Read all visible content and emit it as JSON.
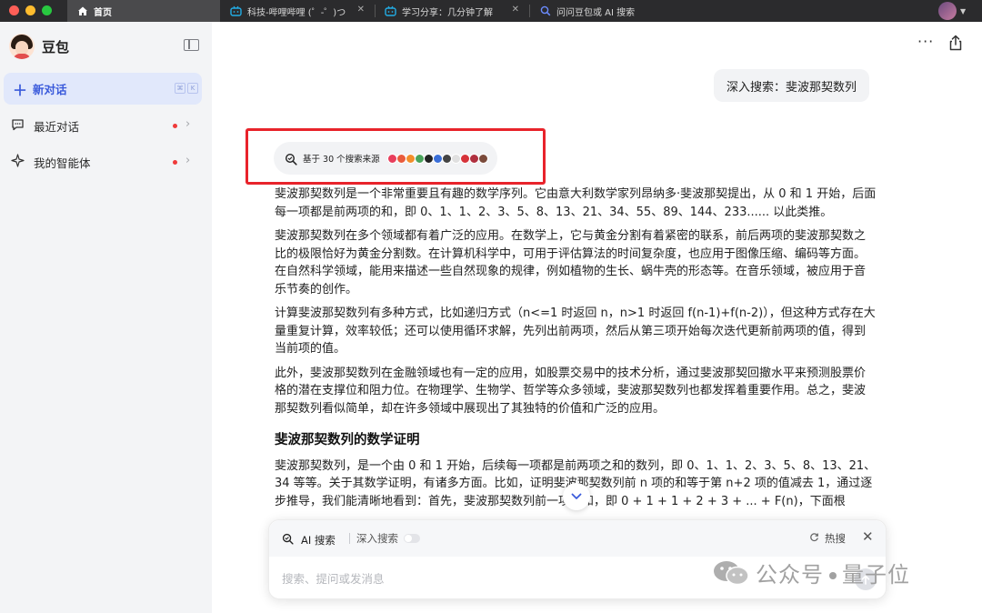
{
  "browser": {
    "tabs": [
      {
        "title": "首页",
        "active": true
      },
      {
        "title": "科技-哔哩哔哩 (゜-゜)つ",
        "active": false
      },
      {
        "title": "学习分享：几分钟了解",
        "active": false
      },
      {
        "title": "问问豆包或 AI 搜索",
        "active": false
      }
    ],
    "close_glyph": "✕"
  },
  "sidebar": {
    "brand": "豆包",
    "new_chat": {
      "label": "新对话",
      "shortcut": [
        "⌘",
        "K"
      ]
    },
    "items": [
      {
        "label": "最近对话",
        "icon": "chat-bubble-icon",
        "has_dot": true
      },
      {
        "label": "我的智能体",
        "icon": "sparkle-icon",
        "has_dot": true
      }
    ],
    "colors": {
      "accent": "#3b5bdb",
      "dot": "#ef3a3a",
      "bg": "#f3f4f6"
    }
  },
  "header": {
    "more": "···"
  },
  "conversation": {
    "user_query": "深入搜索：斐波那契数列",
    "sources_label": "基于 30 个搜索来源",
    "source_colors": [
      "#e83e5c",
      "#e95b3c",
      "#f28e2b",
      "#4aa35b",
      "#222222",
      "#3a6fd8",
      "#444444",
      "#e0e0e0",
      "#d6333a",
      "#b0303f",
      "#7a4a3a"
    ],
    "answer_paragraphs": [
      "斐波那契数列是一个非常重要且有趣的数学序列。它由意大利数学家列昂纳多·斐波那契提出，从 0 和 1 开始，后面每一项都是前两项的和，即 0、1、1、2、3、5、8、13、21、34、55、89、144、233...... 以此类推。",
      "斐波那契数列在多个领域都有着广泛的应用。在数学上，它与黄金分割有着紧密的联系，前后两项的斐波那契数之比的极限恰好为黄金分割数。在计算机科学中，可用于评估算法的时间复杂度，也应用于图像压缩、编码等方面。在自然科学领域，能用来描述一些自然现象的规律，例如植物的生长、蜗牛壳的形态等。在音乐领域，被应用于音乐节奏的创作。",
      "计算斐波那契数列有多种方式，比如递归方式（n<=1 时返回 n，n>1 时返回 f(n-1)+f(n-2)），但这种方式存在大量重复计算，效率较低；还可以使用循环求解，先列出前两项，然后从第三项开始每次迭代更新前两项的值，得到当前项的值。",
      "此外，斐波那契数列在金融领域也有一定的应用，如股票交易中的技术分析，通过斐波那契回撤水平来预测股票价格的潜在支撑位和阻力位。在物理学、生物学、哲学等众多领域，斐波那契数列也都发挥着重要作用。总之，斐波那契数列看似简单，却在许多领域中展现出了其独特的价值和广泛的应用。"
    ],
    "section_heading": "斐波那契数列的数学证明",
    "section_paragraph": "斐波那契数列，是一个由 0 和 1 开始，后续每一项都是前两项之和的数列，即 0、1、1、2、3、5、8、13、21、34 等等。关于其数学证明，有诸多方面。比如，证明斐波那契数列前 n 项的和等于第 n+2 项的值减去 1，通过逐步推导，我们能清晰地看到：首先，斐波那契数列前一项的和，即 0 + 1 + 1 + 2 + 3 + ... + F(n)，下面根"
  },
  "composer": {
    "ai_search_label": "AI 搜索",
    "deep_search_label": "深入搜索",
    "deep_search_on": false,
    "hot_search_label": "热搜",
    "placeholder": "搜索、提问或发消息"
  },
  "watermark": {
    "text_left": "公众号",
    "text_right": "量子位"
  }
}
